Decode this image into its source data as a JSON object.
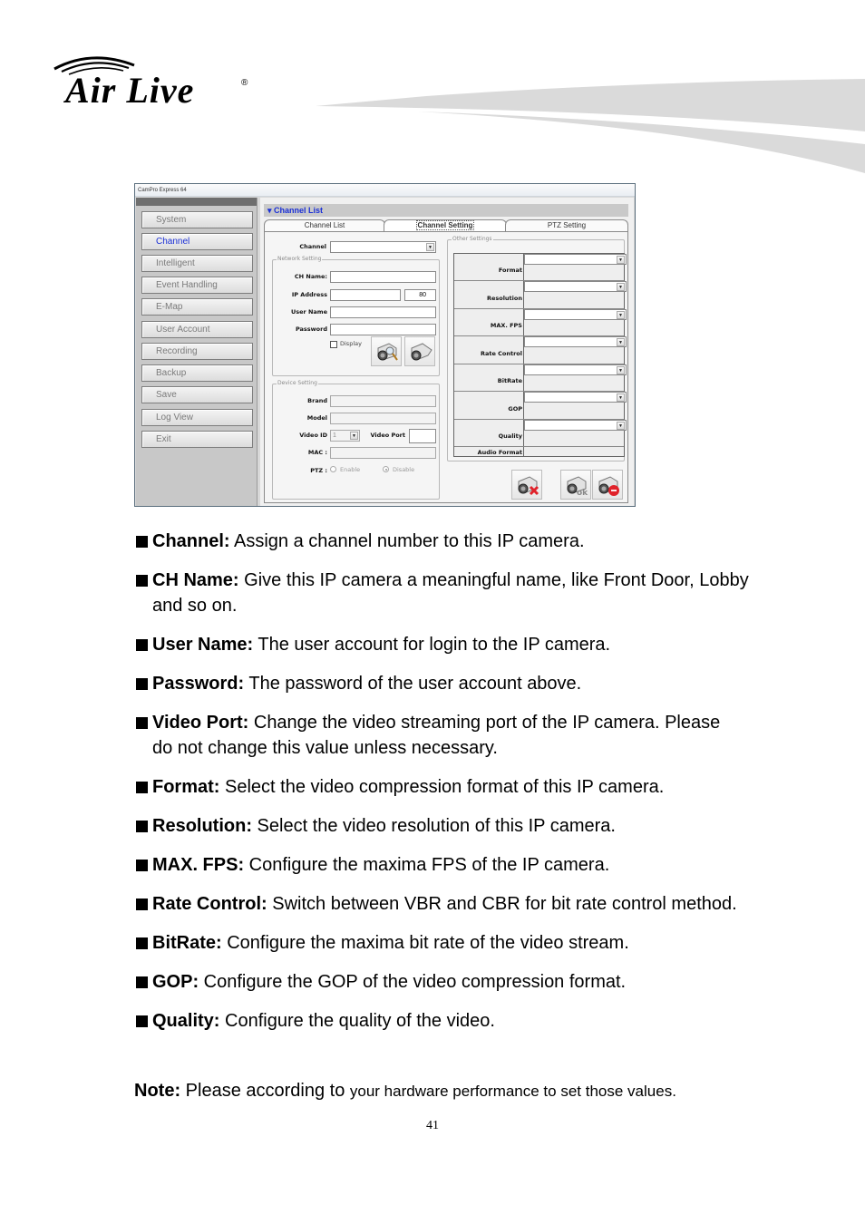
{
  "header": {
    "logo_text": "Air Live",
    "logo_mark": "®"
  },
  "window": {
    "title": "CamPro Express 64",
    "sidebar": {
      "items": [
        {
          "label": "System",
          "active": false
        },
        {
          "label": "Channel",
          "active": true
        },
        {
          "label": "Intelligent",
          "active": false
        },
        {
          "label": "Event Handling",
          "active": false
        },
        {
          "label": "E-Map",
          "active": false
        },
        {
          "label": "User Account",
          "active": false
        },
        {
          "label": "Recording",
          "active": false
        },
        {
          "label": "Backup",
          "active": false
        },
        {
          "label": "Save",
          "active": false
        },
        {
          "label": "Log View",
          "active": false
        },
        {
          "label": "Exit",
          "active": false
        }
      ]
    },
    "main": {
      "header": "Channel List",
      "header_icon": "chevron-double-down-icon",
      "tabs": [
        {
          "label": "Channel List",
          "active": false
        },
        {
          "label": "Channel Setting",
          "active": true
        },
        {
          "label": "PTZ Setting",
          "active": false
        }
      ],
      "channel_label": "Channel",
      "channel_value": "",
      "network_setting": {
        "title": "Network Setting",
        "ch_name_label": "CH Name:",
        "ch_name_value": "",
        "ip_label": "IP Address",
        "ip_value": "",
        "port_value": "80",
        "user_label": "User Name",
        "user_value": "",
        "password_label": "Password",
        "password_value": "",
        "display_label": "Display",
        "display_checked": false,
        "search_button_icon": "camera-search-icon",
        "connect_button_icon": "camera-connect-icon"
      },
      "device_setting": {
        "title": "Device Setting",
        "brand_label": "Brand",
        "brand_value": "",
        "model_label": "Model",
        "model_value": "",
        "video_id_label": "Video ID",
        "video_id_value": "1",
        "video_port_label": "Video Port",
        "video_port_value": "",
        "mac_label": "MAC :",
        "mac_value": "",
        "ptz_label": "PTZ :",
        "ptz_enable_label": "Enable",
        "ptz_disable_label": "Disable",
        "ptz_selected": "Disable"
      },
      "other_settings": {
        "title": "Other Settings",
        "rows": [
          {
            "label": "Format",
            "value": ""
          },
          {
            "label": "Resolution",
            "value": ""
          },
          {
            "label": "MAX. FPS",
            "value": ""
          },
          {
            "label": "Rate Control",
            "value": ""
          },
          {
            "label": "BitRate",
            "value": ""
          },
          {
            "label": "GOP",
            "value": ""
          },
          {
            "label": "Quality",
            "value": ""
          }
        ],
        "audio_format_label": "Audio Format"
      },
      "action_buttons": [
        {
          "name": "delete-camera-button",
          "icon": "camera-delete-icon"
        },
        {
          "name": "ok-button",
          "icon": "camera-ok-icon"
        },
        {
          "name": "cancel-button",
          "icon": "camera-cancel-icon"
        }
      ]
    }
  },
  "document": {
    "bullets": [
      {
        "term": "Channel:",
        "text": " Assign a channel number to this IP camera."
      },
      {
        "term": "CH Name:",
        "text": " Give this IP camera a meaningful name, like Front Door, Lobby and so on."
      },
      {
        "term": "User Name:",
        "text": " The user account for login to the IP camera."
      },
      {
        "term": "Password:",
        "text": " The password of the user account above."
      },
      {
        "term": "Video Port:",
        "text": " Change the video streaming port of the IP camera. Please do not change this value unless necessary."
      },
      {
        "term": "Format:",
        "text": " Select the video compression format of this IP camera."
      },
      {
        "term": "Resolution:",
        "text": " Select the video resolution of this IP camera."
      },
      {
        "term": "MAX. FPS:",
        "text": " Configure the maxima FPS of the IP camera."
      },
      {
        "term": "Rate Control:",
        "text": " Switch between VBR and CBR for bit rate control method."
      },
      {
        "term": "BitRate:",
        "text": " Configure the maxima bit rate of the video stream."
      },
      {
        "term": "GOP:",
        "text": " Configure the GOP of the video compression format."
      },
      {
        "term": "Quality:",
        "text": " Configure the quality of the video."
      }
    ],
    "note": {
      "term": "Note:",
      "text_large": " Please according to ",
      "text_small": "your hardware performance to set those values."
    },
    "page_number": "41"
  },
  "colors": {
    "accent_blue": "#1a2fd6",
    "swoosh_gray": "#dadada"
  }
}
